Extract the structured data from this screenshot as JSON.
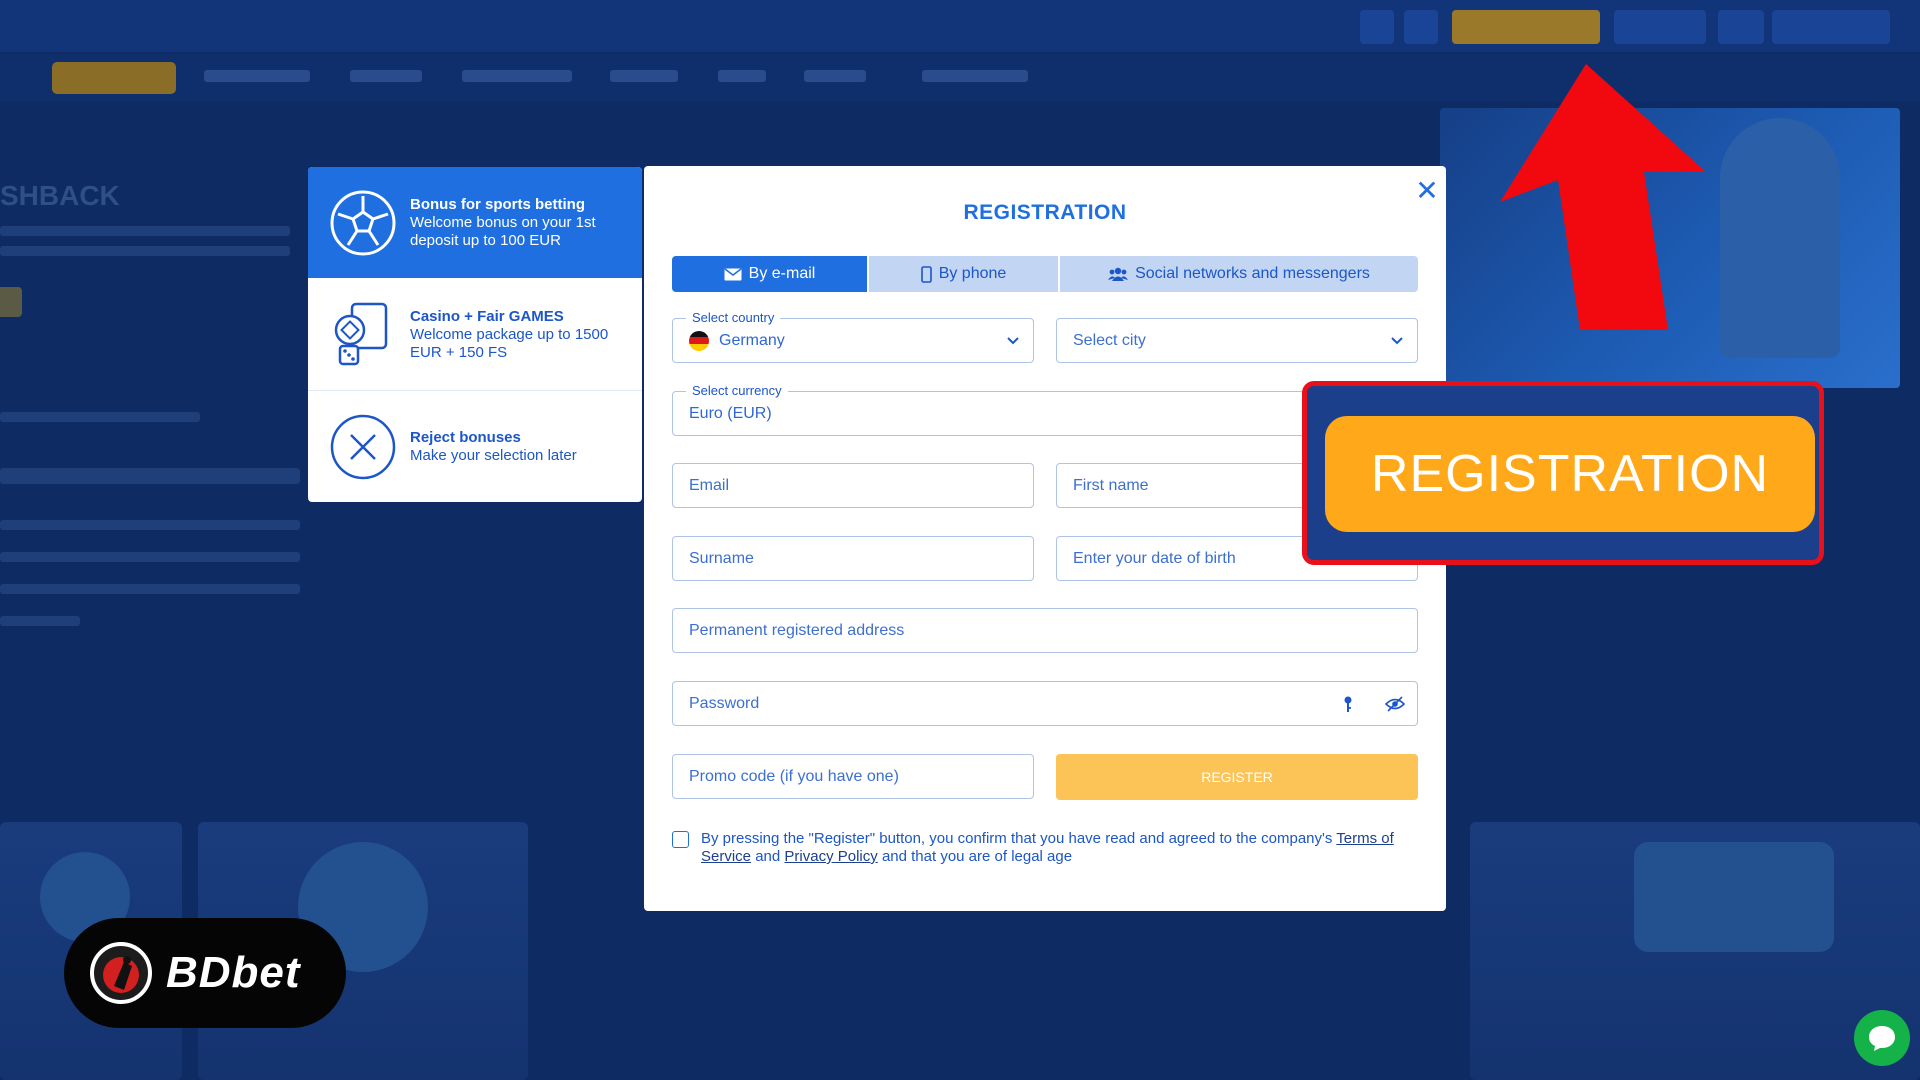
{
  "background": {
    "hero_title": "SHBACK",
    "colors": {
      "bg": "#0e2c63"
    }
  },
  "bonus_panel": {
    "items": [
      {
        "title": "Bonus for sports betting",
        "desc": "Welcome bonus on your 1st deposit up to 100 EUR",
        "icon": "soccer-ball-icon",
        "active": true
      },
      {
        "title": "Casino + Fair GAMES",
        "desc": "Welcome package up to 1500 EUR + 150 FS",
        "icon": "casino-chips-icon",
        "active": false
      },
      {
        "title": "Reject bonuses",
        "desc": "Make your selection later",
        "icon": "reject-x-icon",
        "active": false
      }
    ]
  },
  "modal": {
    "title": "REGISTRATION",
    "tabs": [
      {
        "label": "By e-mail",
        "icon": "envelope-icon",
        "active": true
      },
      {
        "label": "By phone",
        "icon": "phone-icon",
        "active": false
      },
      {
        "label": "Social networks and messengers",
        "icon": "users-icon",
        "active": false
      }
    ],
    "country": {
      "label": "Select country",
      "value": "Germany"
    },
    "city": {
      "placeholder": "Select city"
    },
    "currency": {
      "label": "Select currency",
      "value": "Euro (EUR)"
    },
    "fields": {
      "email": "Email",
      "first_name": "First name",
      "surname": "Surname",
      "dob": "Enter your date of birth",
      "address": "Permanent registered address",
      "password": "Password",
      "promo": "Promo code (if you have one)"
    },
    "register_label": "REGISTER",
    "consent": {
      "prefix": "By pressing the \"Register\" button, you confirm that you have read and agreed to the company's",
      "terms": "Terms of Service",
      "and": "and",
      "privacy": "Privacy Policy",
      "suffix": "and that you are of legal age"
    },
    "colors": {
      "primary": "#1f6fe0",
      "register": "#fcc356"
    }
  },
  "callout": {
    "label": "REGISTRATION",
    "colors": {
      "button": "#ffa81a",
      "border": "#e8101a"
    }
  },
  "logo": {
    "text": "BDbet"
  }
}
